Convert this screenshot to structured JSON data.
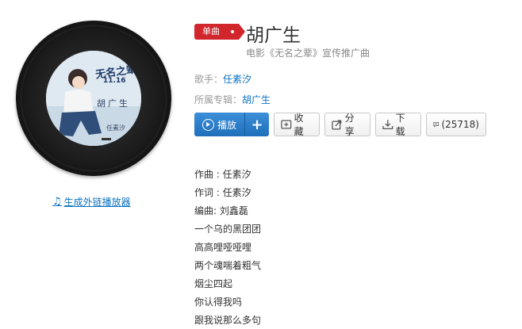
{
  "album_cover": {
    "title": "无名之辈",
    "date": "11.16",
    "song": "胡广生",
    "artist": "任素汐"
  },
  "ext_link": {
    "label": "生成外链播放器"
  },
  "header": {
    "badge": "单曲",
    "title": "胡广生",
    "subtitle": "电影《无名之辈》宣传推广曲"
  },
  "meta": {
    "singer_label": "歌手：",
    "singer_value": "任素汐",
    "album_label": "所属专辑：",
    "album_value": "胡广生"
  },
  "buttons": {
    "play": "播放",
    "add": "+",
    "collect": "收藏",
    "share": "分享",
    "download": "下载",
    "comment": "(25718)"
  },
  "lyrics": [
    "作曲 : 任素汐",
    "作词 : 任素汐",
    "编曲: 刘鑫磊",
    "一个乌的黑团团",
    "高高哩哑哑哩",
    "两个魂喘着粗气",
    "烟尘四起",
    "你认得我吗",
    "跟我说那么多句"
  ]
}
